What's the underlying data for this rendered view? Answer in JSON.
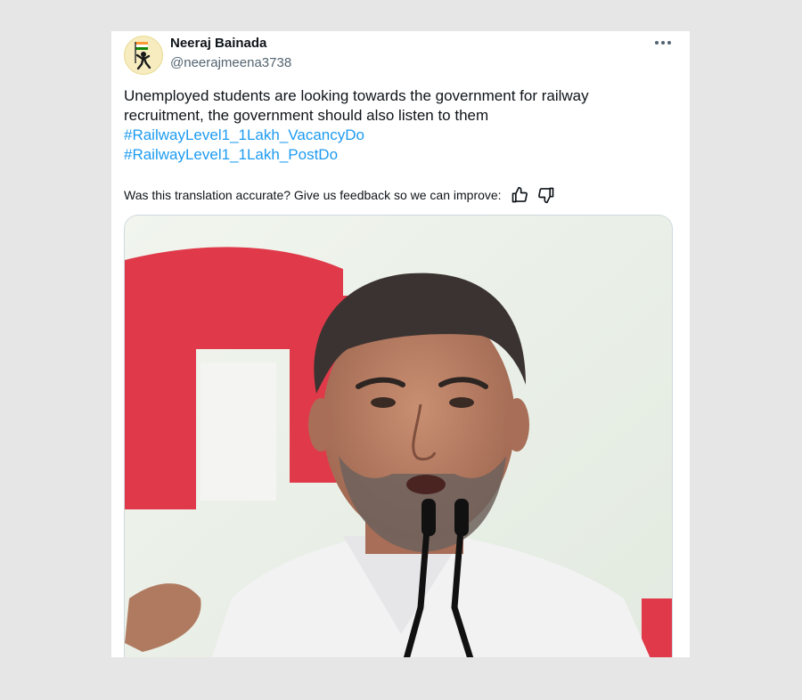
{
  "author": {
    "name": "Neeraj Bainada",
    "handle": "@neerajmeena3738"
  },
  "tweet": {
    "text": "Unemployed students are looking towards the government for railway recruitment, the government should also listen to them",
    "hashtags": [
      "#RailwayLevel1_1Lakh_VacancyDo",
      "#RailwayLevel1_1Lakh_PostDo"
    ]
  },
  "translation_feedback": {
    "prompt": "Was this translation accurate? Give us feedback so we can improve:",
    "thumbs_up_icon": "thumbs-up-icon",
    "thumbs_down_icon": "thumbs-down-icon"
  },
  "menu": {
    "icon": "more-options-icon"
  },
  "colors": {
    "link": "#1d9bf0",
    "text": "#0f1419",
    "secondary_text": "#536471",
    "page_background": "#e6e6e6"
  }
}
